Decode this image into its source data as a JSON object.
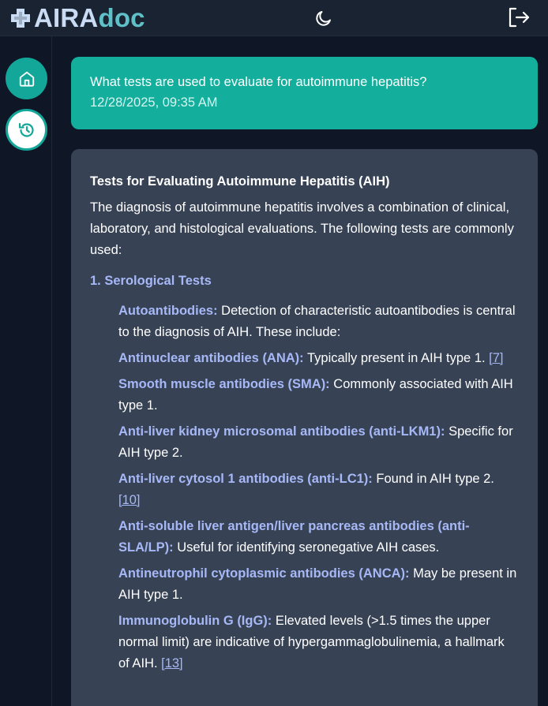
{
  "header": {
    "logo_part1": "AIRA",
    "logo_part2": "doc",
    "theme_icon": "moon-icon",
    "logout_icon": "logout-icon"
  },
  "sidebar": {
    "items": [
      {
        "icon": "home-icon"
      },
      {
        "icon": "history-icon"
      }
    ]
  },
  "colors": {
    "accent": "#13ae9c",
    "link": "#a7b8f7",
    "card": "#374255",
    "background": "#0f1726"
  },
  "user_message": {
    "question": "What tests are used to evaluate for autoimmune hepatitis?",
    "timestamp": "12/28/2025, 09:35 AM"
  },
  "answer": {
    "title": "Tests for Evaluating Autoimmune Hepatitis (AIH)",
    "intro": "The diagnosis of autoimmune hepatitis involves a combination of clinical, laboratory, and histological evaluations. The following tests are commonly used:",
    "section_title": "1. Serological Tests",
    "items": [
      {
        "term": "Autoantibodies:",
        "text": " Detection of characteristic autoantibodies is central to the diagnosis of AIH. These include:",
        "ref": ""
      },
      {
        "term": "Antinuclear antibodies (ANA):",
        "text": " Typically present in AIH type 1. ",
        "ref": "[7]"
      },
      {
        "term": "Smooth muscle antibodies (SMA):",
        "text": " Commonly associated with AIH type 1.",
        "ref": ""
      },
      {
        "term": "Anti-liver kidney microsomal antibodies (anti-LKM1):",
        "text": " Specific for AIH type 2.",
        "ref": ""
      },
      {
        "term": "Anti-liver cytosol 1 antibodies (anti-LC1):",
        "text": " Found in AIH type 2. ",
        "ref": "[10]"
      },
      {
        "term": "Anti-soluble liver antigen/liver pancreas antibodies (anti-SLA/LP):",
        "text": " Useful for identifying seronegative AIH cases.",
        "ref": ""
      },
      {
        "term": "Antineutrophil cytoplasmic antibodies (ANCA):",
        "text": " May be present in AIH type 1.",
        "ref": ""
      },
      {
        "term": "Immunoglobulin G (IgG):",
        "text": " Elevated levels (>1.5 times the upper normal limit) are indicative of hypergammaglobulinemia, a hallmark of AIH. ",
        "ref": "[13]"
      }
    ]
  }
}
